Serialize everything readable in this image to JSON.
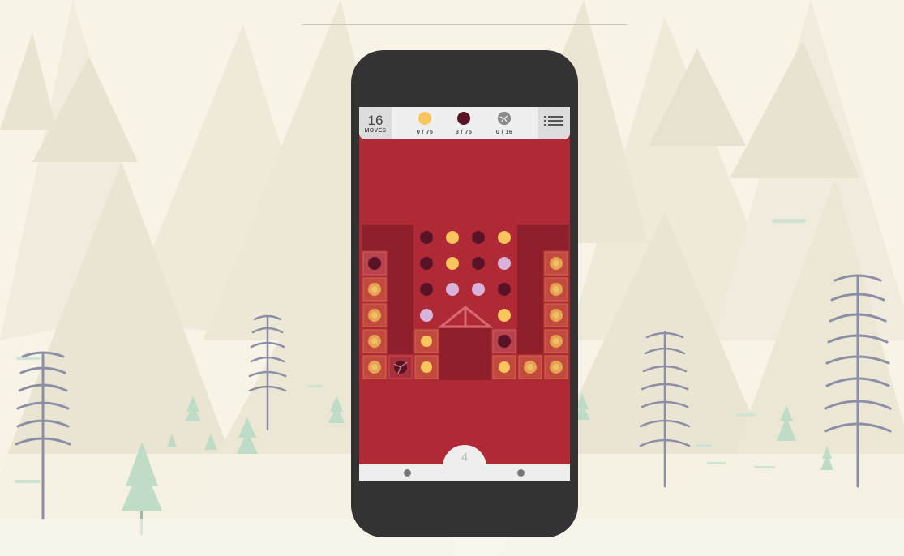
{
  "hud": {
    "moves_value": "16",
    "moves_label": "MOVES",
    "goals": [
      {
        "icon": "yellow-dot-icon",
        "color": "#f9c55c",
        "count": "0 / 75"
      },
      {
        "icon": "maroon-dot-icon",
        "color": "#5a1326",
        "count": "3 / 75"
      },
      {
        "icon": "cracked-orb-icon",
        "color": "#7b7b7b",
        "count": "0 / 16"
      }
    ],
    "menu_icon": "list-menu-icon"
  },
  "level": {
    "current": "4"
  },
  "colors": {
    "board_background": "#b02a35",
    "yellow": "#f9c55c",
    "maroon": "#5a1326",
    "lilac": "#d7b2d9",
    "orange_gem": "#e6a350",
    "dark_well": "#8f1f2a",
    "hud_background": "#eeeeee"
  },
  "board": {
    "cols": 8,
    "rows": 6,
    "cells": [
      [
        "wall",
        "wall",
        "maroon",
        "yellow",
        "maroon",
        "yellow",
        "wall",
        "wall"
      ],
      [
        "gem-maroon",
        "wall",
        "maroon",
        "yellow",
        "maroon",
        "lilac",
        "wall",
        "gem-orange"
      ],
      [
        "gem-orange",
        "wall",
        "maroon",
        "lilac",
        "lilac",
        "maroon",
        "wall",
        "gem-orange"
      ],
      [
        "gem-orange",
        "wall",
        "lilac",
        "trap",
        "trap",
        "yellow",
        "wall",
        "gem-orange"
      ],
      [
        "gem-orange",
        "wall",
        "box-yellow",
        "well",
        "well",
        "gem-maroon",
        "wall",
        "gem-orange"
      ],
      [
        "gem-orange",
        "gem-cracked",
        "box-yellow",
        "well",
        "well",
        "box-yellow",
        "gem-orange",
        "gem-orange"
      ]
    ]
  }
}
